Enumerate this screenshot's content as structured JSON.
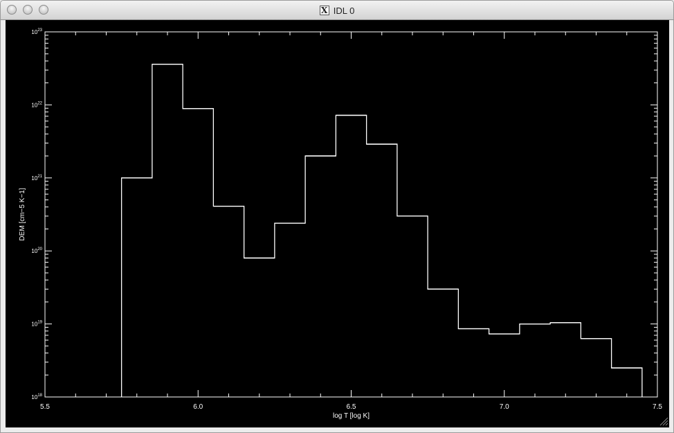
{
  "window": {
    "title": "IDL 0",
    "icon": "x11-icon",
    "icon_glyph": "X"
  },
  "chart_data": {
    "type": "line",
    "style": "histogram-step",
    "xlabel": "log T [log K]",
    "ylabel": "DEM [cm−5 K−1]",
    "xlim": [
      5.5,
      7.5
    ],
    "ylim": [
      1e+18,
      1e+23
    ],
    "ylog": true,
    "grid": false,
    "x_ticks": [
      5.5,
      6.0,
      6.5,
      7.0,
      7.5
    ],
    "x_tick_labels": [
      "5.5",
      "6.0",
      "6.5",
      "7.0",
      "7.5"
    ],
    "y_tick_exponents": [
      18,
      19,
      20,
      21,
      22,
      23
    ],
    "y_tick_base": "10",
    "bin_edges": [
      5.75,
      5.85,
      5.95,
      6.05,
      6.15,
      6.25,
      6.35,
      6.45,
      6.55,
      6.65,
      6.75,
      6.85,
      6.95,
      7.05,
      7.15,
      7.25,
      7.35,
      7.45
    ],
    "values": [
      1e+21,
      3.6e+22,
      8.9e+21,
      4.1e+20,
      8e+19,
      2.4e+20,
      2e+21,
      7.2e+21,
      2.9e+21,
      3e+20,
      3e+19,
      8.6e+18,
      7.3e+18,
      1e+19,
      1.04e+19,
      6.3e+18,
      2.5e+18
    ],
    "line_color": "#ffffff",
    "background": "#000000"
  }
}
